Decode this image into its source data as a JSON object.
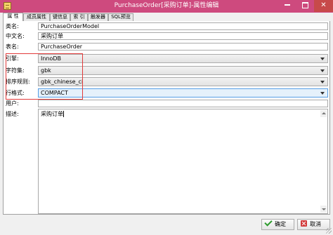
{
  "window": {
    "title": "PurchaseOrder[采购订单]-属性编辑",
    "title_bg": "#ce4a7e",
    "close_bg": "#c74a4a"
  },
  "tabs": [
    {
      "label": "属 性",
      "active": true
    },
    {
      "label": "成员属性",
      "active": false
    },
    {
      "label": "键信息",
      "active": false
    },
    {
      "label": "索 引",
      "active": false
    },
    {
      "label": "触发器",
      "active": false
    },
    {
      "label": "SQL预览",
      "active": false
    }
  ],
  "form": {
    "class_name": {
      "label": "类名:",
      "value": "PurchaseOrderModel"
    },
    "chinese_name": {
      "label": "中文名:",
      "value": "采购订单"
    },
    "table_name": {
      "label": "表名:",
      "value": "PurchaseOrder"
    },
    "engine": {
      "label": "引擎:",
      "value": "InnoDB"
    },
    "charset": {
      "label": "字符集:",
      "value": "gbk"
    },
    "collation": {
      "label": "排序规则:",
      "value": "gbk_chinese_ci"
    },
    "row_format": {
      "label": "行格式:",
      "value": "COMPACT"
    },
    "user": {
      "label": "用户:",
      "value": ""
    },
    "description": {
      "label": "描述:",
      "value": "采购订单"
    }
  },
  "highlight_color": "#e23a3a",
  "buttons": {
    "ok_label": "确定",
    "cancel_label": "取消",
    "ok_icon": "checkmark-icon",
    "cancel_icon": "cancel-x-icon"
  }
}
